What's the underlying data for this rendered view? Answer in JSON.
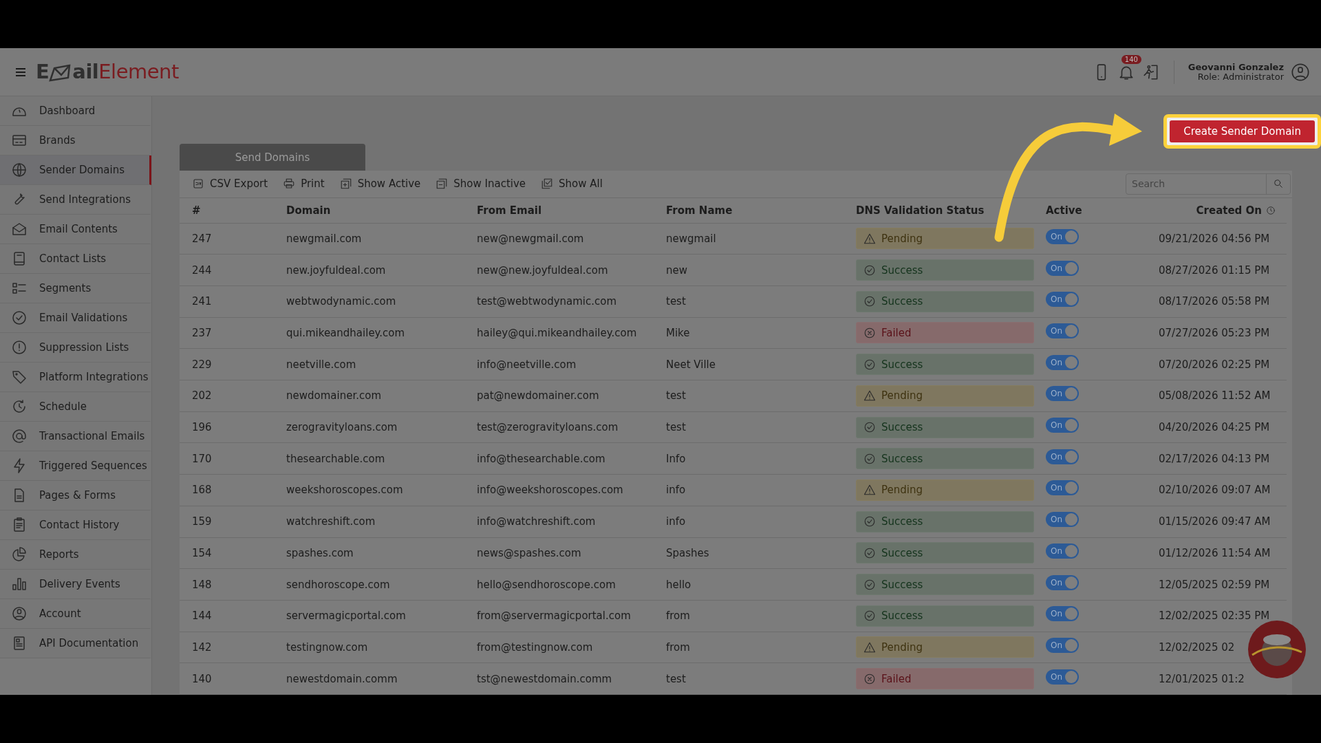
{
  "header": {
    "logo": [
      "E",
      "ail",
      "Element"
    ],
    "notification_count": "140",
    "user_name": "Geovanni Gonzalez",
    "user_role": "Role: Administrator"
  },
  "sidebar": {
    "items": [
      {
        "label": "Dashboard",
        "selected": false
      },
      {
        "label": "Brands",
        "selected": false
      },
      {
        "label": "Sender Domains",
        "selected": true
      },
      {
        "label": "Send Integrations",
        "selected": false
      },
      {
        "label": "Email Contents",
        "selected": false
      },
      {
        "label": "Contact Lists",
        "selected": false
      },
      {
        "label": "Segments",
        "selected": false
      },
      {
        "label": "Email Validations",
        "selected": false
      },
      {
        "label": "Suppression Lists",
        "selected": false
      },
      {
        "label": "Platform Integrations",
        "selected": false
      },
      {
        "label": "Schedule",
        "selected": false
      },
      {
        "label": "Transactional Emails",
        "selected": false
      },
      {
        "label": "Triggered Sequences",
        "selected": false
      },
      {
        "label": "Pages & Forms",
        "selected": false
      },
      {
        "label": "Contact History",
        "selected": false
      },
      {
        "label": "Reports",
        "selected": false
      },
      {
        "label": "Delivery Events",
        "selected": false
      },
      {
        "label": "Account",
        "selected": false
      },
      {
        "label": "API Documentation",
        "selected": false
      }
    ]
  },
  "create_button": "Create Sender Domain",
  "tab": "Send Domains",
  "toolbar": [
    "CSV Export",
    "Print",
    "Show Active",
    "Show Inactive",
    "Show All"
  ],
  "search": {
    "placeholder": "Search"
  },
  "table": {
    "columns": [
      "#",
      "Domain",
      "From Email",
      "From Name",
      "DNS Validation Status",
      "Active",
      "Created On"
    ],
    "rows": [
      {
        "id": "247",
        "domain": "newgmail.com",
        "from_email": "new@newgmail.com",
        "from_name": "newgmail",
        "status": {
          "kind": "pending",
          "label": "Pending"
        },
        "active": true,
        "active_label": "On",
        "created": "09/21/2026 04:56 PM"
      },
      {
        "id": "244",
        "domain": "new.joyfuldeal.com",
        "from_email": "new@new.joyfuldeal.com",
        "from_name": "new",
        "status": {
          "kind": "success",
          "label": "Success"
        },
        "active": true,
        "active_label": "On",
        "created": "08/27/2026 01:15 PM"
      },
      {
        "id": "241",
        "domain": "webtwodynamic.com",
        "from_email": "test@webtwodynamic.com",
        "from_name": "test",
        "status": {
          "kind": "success",
          "label": "Success"
        },
        "active": true,
        "active_label": "On",
        "created": "08/17/2026 05:58 PM"
      },
      {
        "id": "237",
        "domain": "qui.mikeandhailey.com",
        "from_email": "hailey@qui.mikeandhailey.com",
        "from_name": "Mike",
        "status": {
          "kind": "failed",
          "label": "Failed"
        },
        "active": true,
        "active_label": "On",
        "created": "07/27/2026 05:23 PM"
      },
      {
        "id": "229",
        "domain": "neetville.com",
        "from_email": "info@neetville.com",
        "from_name": "Neet Ville",
        "status": {
          "kind": "success",
          "label": "Success"
        },
        "active": true,
        "active_label": "On",
        "created": "07/20/2026 02:25 PM"
      },
      {
        "id": "202",
        "domain": "newdomainer.com",
        "from_email": "pat@newdomainer.com",
        "from_name": "test",
        "status": {
          "kind": "pending",
          "label": "Pending"
        },
        "active": true,
        "active_label": "On",
        "created": "05/08/2026 11:52 AM"
      },
      {
        "id": "196",
        "domain": "zerogravityloans.com",
        "from_email": "test@zerogravityloans.com",
        "from_name": "test",
        "status": {
          "kind": "success",
          "label": "Success"
        },
        "active": true,
        "active_label": "On",
        "created": "04/20/2026 04:25 PM"
      },
      {
        "id": "170",
        "domain": "thesearchable.com",
        "from_email": "info@thesearchable.com",
        "from_name": "Info",
        "status": {
          "kind": "success",
          "label": "Success"
        },
        "active": true,
        "active_label": "On",
        "created": "02/17/2026 04:13 PM"
      },
      {
        "id": "168",
        "domain": "weekshoroscopes.com",
        "from_email": "info@weekshoroscopes.com",
        "from_name": "info",
        "status": {
          "kind": "pending",
          "label": "Pending"
        },
        "active": true,
        "active_label": "On",
        "created": "02/10/2026 09:07 AM"
      },
      {
        "id": "159",
        "domain": "watchreshift.com",
        "from_email": "info@watchreshift.com",
        "from_name": "info",
        "status": {
          "kind": "success",
          "label": "Success"
        },
        "active": true,
        "active_label": "On",
        "created": "01/15/2026 09:47 AM"
      },
      {
        "id": "154",
        "domain": "spashes.com",
        "from_email": "news@spashes.com",
        "from_name": "Spashes",
        "status": {
          "kind": "success",
          "label": "Success"
        },
        "active": true,
        "active_label": "On",
        "created": "01/12/2026 11:54 AM"
      },
      {
        "id": "148",
        "domain": "sendhoroscope.com",
        "from_email": "hello@sendhoroscope.com",
        "from_name": "hello",
        "status": {
          "kind": "success",
          "label": "Success"
        },
        "active": true,
        "active_label": "On",
        "created": "12/05/2025 02:59 PM"
      },
      {
        "id": "144",
        "domain": "servermagicportal.com",
        "from_email": "from@servermagicportal.com",
        "from_name": "from",
        "status": {
          "kind": "success",
          "label": "Success"
        },
        "active": true,
        "active_label": "On",
        "created": "12/02/2025 02:35 PM"
      },
      {
        "id": "142",
        "domain": "testingnow.com",
        "from_email": "from@testingnow.com",
        "from_name": "from",
        "status": {
          "kind": "pending",
          "label": "Pending"
        },
        "active": true,
        "active_label": "On",
        "created": "12/02/2025 02"
      },
      {
        "id": "140",
        "domain": "newestdomain.comm",
        "from_email": "tst@newestdomain.comm",
        "from_name": "test",
        "status": {
          "kind": "failed",
          "label": "Failed"
        },
        "active": true,
        "active_label": "On",
        "created": "12/01/2025 01:2"
      }
    ]
  }
}
